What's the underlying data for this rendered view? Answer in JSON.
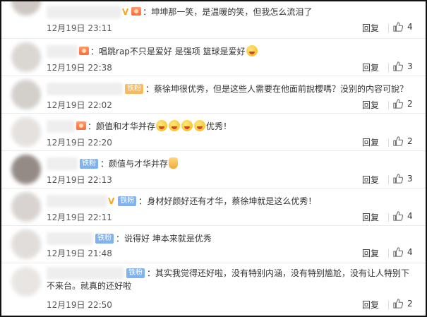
{
  "reply_label": "回复",
  "comments": [
    {
      "text": "坤坤那一笑，是温暖的笑，但我怎么流泪了",
      "time": "12月19日 23:11",
      "likes": "4"
    },
    {
      "text": "唱跳rap不只是爱好 是强项 篮球是爱好",
      "time": "12月19日 22:38",
      "likes": "3"
    },
    {
      "badge": "铁粉",
      "text": "蔡徐坤很优秀，但是这些人需要在他面前說櫻嗎？没别的内容可說？",
      "time": "12月19日 22:02",
      "likes": "2"
    },
    {
      "text": "颜值和才华并存",
      "text2": "优秀！",
      "time": "12月19日 22:20",
      "likes": "2"
    },
    {
      "badge": "铁粉",
      "text": "颜值与才华并存",
      "time": "12月19日 22:13",
      "likes": "3"
    },
    {
      "badge": "铁粉",
      "text": "身材好颜好还有才华，蔡徐坤就是这么优秀！",
      "time": "12月19日 22:11",
      "likes": "4"
    },
    {
      "badge": "铁粉",
      "text": "说得好 坤本来就是优秀",
      "time": "12月19日 21:48",
      "likes": "4"
    },
    {
      "badge": "铁粉",
      "text": "其实我觉得还好啦，没有特别内涵，没有特别尴尬，没有让人特别下不来台。就真的还好啦",
      "time": "12月19日 22:50",
      "likes": "2"
    }
  ]
}
